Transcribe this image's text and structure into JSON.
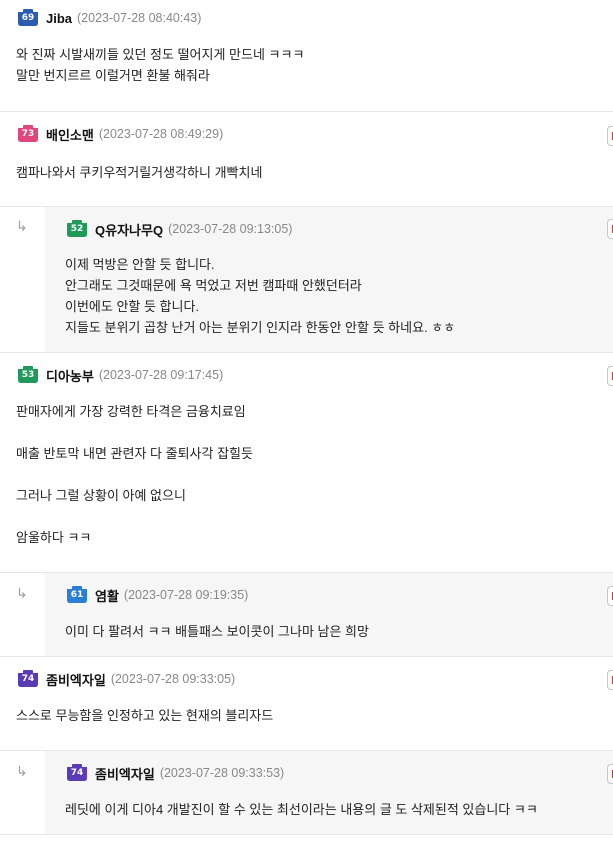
{
  "comments": [
    {
      "nick": "Jiba",
      "level": "69",
      "badge_color": "#2a5db0",
      "time": "(2023-07-28 08:40:43)",
      "lines": [
        "와 진짜 시발새끼들 있던 정도 떨어지게 만드네 ㅋㅋㅋ",
        "말만 번지르르 이럴거면 환불 해줘라"
      ]
    },
    {
      "nick": "배인소맨",
      "level": "73",
      "badge_color": "#e0457b",
      "time": "(2023-07-28 08:49:29)",
      "lines": [
        "캠파나와서 쿠키우적거릴거생각하니 개빡치네"
      ]
    },
    {
      "nick": "Q유자나무Q",
      "level": "52",
      "badge_color": "#1f9a5b",
      "time": "(2023-07-28 09:13:05)",
      "reply_arrow": "↳",
      "lines": [
        "이제 먹방은 안할 듯 합니다.",
        "안그래도 그것때문에 욕 먹었고 저번 캠파때 안했던터라",
        "이번에도 안할 듯 합니다.",
        "지들도 분위기 곱창 난거 아는 분위기 인지라 한동안 안할 듯 하네요. ㅎㅎ"
      ]
    },
    {
      "nick": "디아농부",
      "level": "53",
      "badge_color": "#1f9a5b",
      "time": "(2023-07-28 09:17:45)",
      "lines": [
        "판매자에게 가장 강력한 타격은 금융치료임",
        "매출 반토막 내면 관련자 다 줄퇴사각 잡힐듯",
        "그러나 그럴 상황이 아예 없으니",
        "암울하다 ㅋㅋ"
      ]
    },
    {
      "nick": "염활",
      "level": "61",
      "badge_color": "#2a7fd4",
      "time": "(2023-07-28 09:19:35)",
      "reply_arrow": "↳",
      "lines": [
        "이미 다 팔려서 ㅋㅋ 배틀패스 보이콧이 그나마 남은 희망"
      ]
    },
    {
      "nick": "좀비엑자일",
      "level": "74",
      "badge_color": "#5b3bb5",
      "time": "(2023-07-28 09:33:05)",
      "lines": [
        "스스로 무능함을 인정하고 있는 현재의 블리자드"
      ]
    },
    {
      "nick": "좀비엑자일",
      "level": "74",
      "badge_color": "#5b3bb5",
      "time": "(2023-07-28 09:33:53)",
      "reply_arrow": "↳",
      "lines": [
        "레딧에 이게 디아4 개발진이 할 수 있는 최선이라는 내용의 글 도 삭제된적 있습니다 ㅋㅋ"
      ]
    }
  ]
}
